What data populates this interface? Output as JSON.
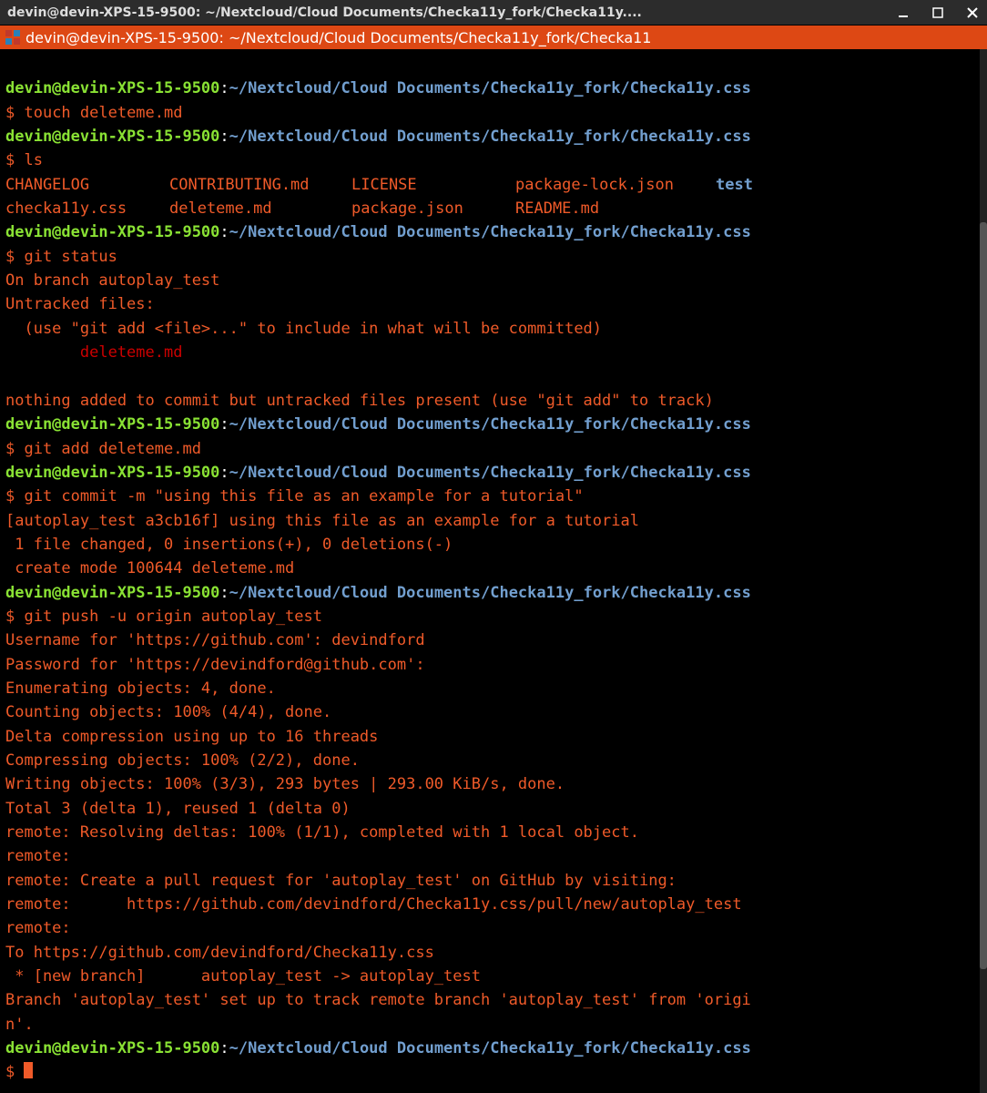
{
  "titlebar": {
    "text": "devin@devin-XPS-15-9500: ~/Nextcloud/Cloud Documents/Checka11y_fork/Checka11y...."
  },
  "tab": {
    "text": "devin@devin-XPS-15-9500: ~/Nextcloud/Cloud Documents/Checka11y_fork/Checka11"
  },
  "prompt": {
    "user_host": "devin@devin-XPS-15-9500",
    "sep": ":",
    "path": "~/Nextcloud/Cloud Documents/Checka11y_fork/Checka11y.css",
    "dollar": "$ "
  },
  "cmds": {
    "touch": "touch deleteme.md",
    "ls": "ls",
    "git_status": "git status",
    "git_add": "git add deleteme.md",
    "git_commit": "git commit -m \"using this file as an example for a tutorial\"",
    "git_push": "git push -u origin autoplay_test"
  },
  "ls_out": {
    "r1": {
      "c1": "CHANGELOG",
      "c2": "CONTRIBUTING.md",
      "c3": "LICENSE",
      "c4": "package-lock.json",
      "c5": "test"
    },
    "r2": {
      "c1": "checka11y.css",
      "c2": "deleteme.md",
      "c3": "package.json",
      "c4": "README.md"
    }
  },
  "status": {
    "branch": "On branch autoplay_test",
    "untracked_head": "Untracked files:",
    "untracked_hint": "  (use \"git add <file>...\" to include in what will be committed)",
    "untracked_file": "        deleteme.md",
    "nothing": "nothing added to commit but untracked files present (use \"git add\" to track)"
  },
  "commit_out": {
    "l1": "[autoplay_test a3cb16f] using this file as an example for a tutorial",
    "l2": " 1 file changed, 0 insertions(+), 0 deletions(-)",
    "l3": " create mode 100644 deleteme.md"
  },
  "push_out": {
    "l1": "Username for 'https://github.com': devindford",
    "l2": "Password for 'https://devindford@github.com': ",
    "l3": "Enumerating objects: 4, done.",
    "l4": "Counting objects: 100% (4/4), done.",
    "l5": "Delta compression using up to 16 threads",
    "l6": "Compressing objects: 100% (2/2), done.",
    "l7": "Writing objects: 100% (3/3), 293 bytes | 293.00 KiB/s, done.",
    "l8": "Total 3 (delta 1), reused 1 (delta 0)",
    "l9": "remote: Resolving deltas: 100% (1/1), completed with 1 local object.",
    "l10": "remote: ",
    "l11": "remote: Create a pull request for 'autoplay_test' on GitHub by visiting:",
    "l12": "remote:      https://github.com/devindford/Checka11y.css/pull/new/autoplay_test",
    "l13": "remote: ",
    "l14": "To https://github.com/devindford/Checka11y.css",
    "l15": " * [new branch]      autoplay_test -> autoplay_test",
    "l16": "Branch 'autoplay_test' set up to track remote branch 'autoplay_test' from 'origi",
    "l17": "n'."
  }
}
